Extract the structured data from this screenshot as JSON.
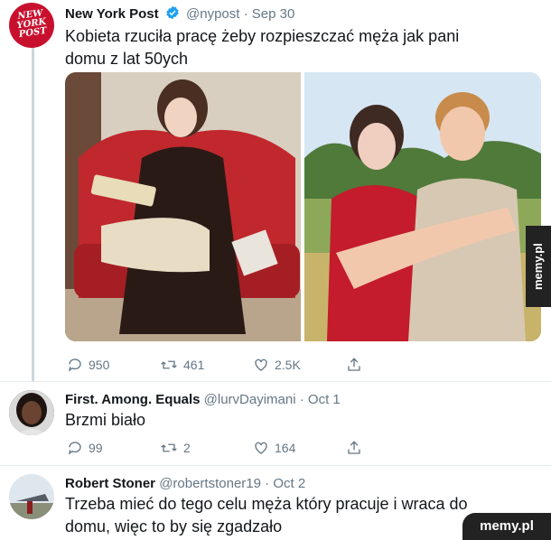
{
  "tweet_main": {
    "logo_line1": "NEW",
    "logo_line2": "YORK",
    "logo_line3": "POST",
    "name": "New York Post",
    "handle": "@nypost",
    "separator": "·",
    "date": "Sep 30",
    "text_line1": "Kobieta rzuciła pracę żeby rozpieszczać męża jak pani",
    "text_line2": "domu z lat 50ych",
    "replies": "950",
    "retweets": "461",
    "likes": "2.5K"
  },
  "reply1": {
    "name": "First. Among. Equals",
    "handle": "@lurvDayimani",
    "separator": "·",
    "date": "Oct 1",
    "text": "Brzmi biało",
    "replies": "99",
    "retweets": "2",
    "likes": "164"
  },
  "reply2": {
    "name": "Robert Stoner",
    "handle": "@robertstoner19",
    "separator": "·",
    "date": "Oct 2",
    "text_line1": "Trzeba mieć do tego celu męża który pracuje i wraca do",
    "text_line2": "domu, więc to by się zgadzało"
  },
  "watermarks": {
    "side": "memy.pl",
    "bottom": "memy.pl"
  },
  "colors": {
    "twitter_blue": "#1da1f2",
    "nyp_red": "#c8102e",
    "meta_gray": "#657786"
  }
}
